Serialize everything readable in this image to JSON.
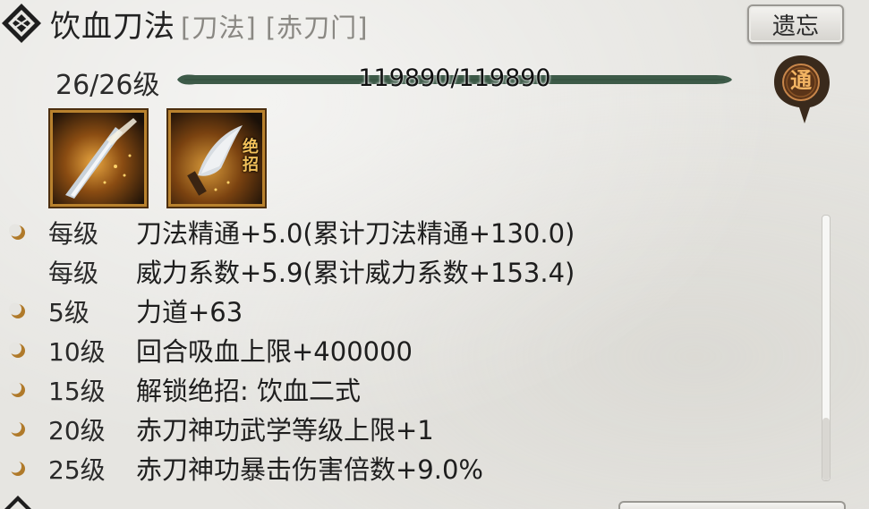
{
  "skill": {
    "name": "饮血刀法",
    "tags": "[刀法] [赤刀门]",
    "forget_label": "遗忘",
    "level_text": "26/26级",
    "xp_text": "119890/119890",
    "xp_progress": 1.0,
    "seal_char": "通",
    "ult_label": "绝招"
  },
  "effects": [
    {
      "req": "每级",
      "desc": "刀法精通+5.0(累计刀法精通+130.0)",
      "bullet": true
    },
    {
      "req": "每级",
      "desc": "威力系数+5.9(累计威力系数+153.4)",
      "bullet": false
    },
    {
      "req": "5级",
      "desc": "力道+63",
      "bullet": true
    },
    {
      "req": "10级",
      "desc": "回合吸血上限+400000",
      "bullet": true
    },
    {
      "req": "15级",
      "desc": "解锁绝招:  饮血二式",
      "bullet": true
    },
    {
      "req": "20级",
      "desc": "赤刀神功武学等级上限+1",
      "bullet": true
    },
    {
      "req": "25级",
      "desc": "赤刀神功暴击伤害倍数+9.0%",
      "bullet": true
    }
  ],
  "colors": {
    "bar": "#3d5a48",
    "bullet": "#b07a2a",
    "seal": "#3a2a1c",
    "icon_border": "#b9822e"
  },
  "icons": {
    "title": "diamond-emblem-icon",
    "seal": "ink-seal-icon",
    "bullet": "crescent-bullet-icon"
  }
}
